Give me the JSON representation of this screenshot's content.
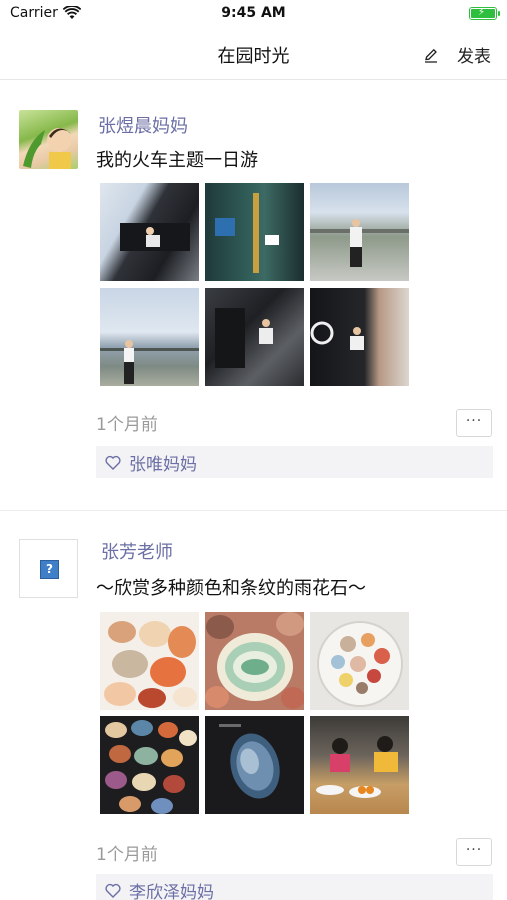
{
  "status_bar": {
    "carrier": "Carrier",
    "time": "9:45 AM"
  },
  "navbar": {
    "title": "在园时光",
    "publish_label": "发表"
  },
  "posts": [
    {
      "author": "张煜晨妈妈",
      "content": "我的火车主题一日游",
      "timestamp": "1个月前",
      "more_label": "···",
      "liked_by": "张唯妈妈"
    },
    {
      "author": "张芳老师",
      "content": "～欣赏多种颜色和条纹的雨花石～",
      "timestamp": "1个月前",
      "more_label": "···",
      "liked_by": "李欣泽妈妈"
    }
  ],
  "colors": {
    "link": "#6b6fa5",
    "battery": "#2fbf3f",
    "muted": "#9a9a9a"
  }
}
